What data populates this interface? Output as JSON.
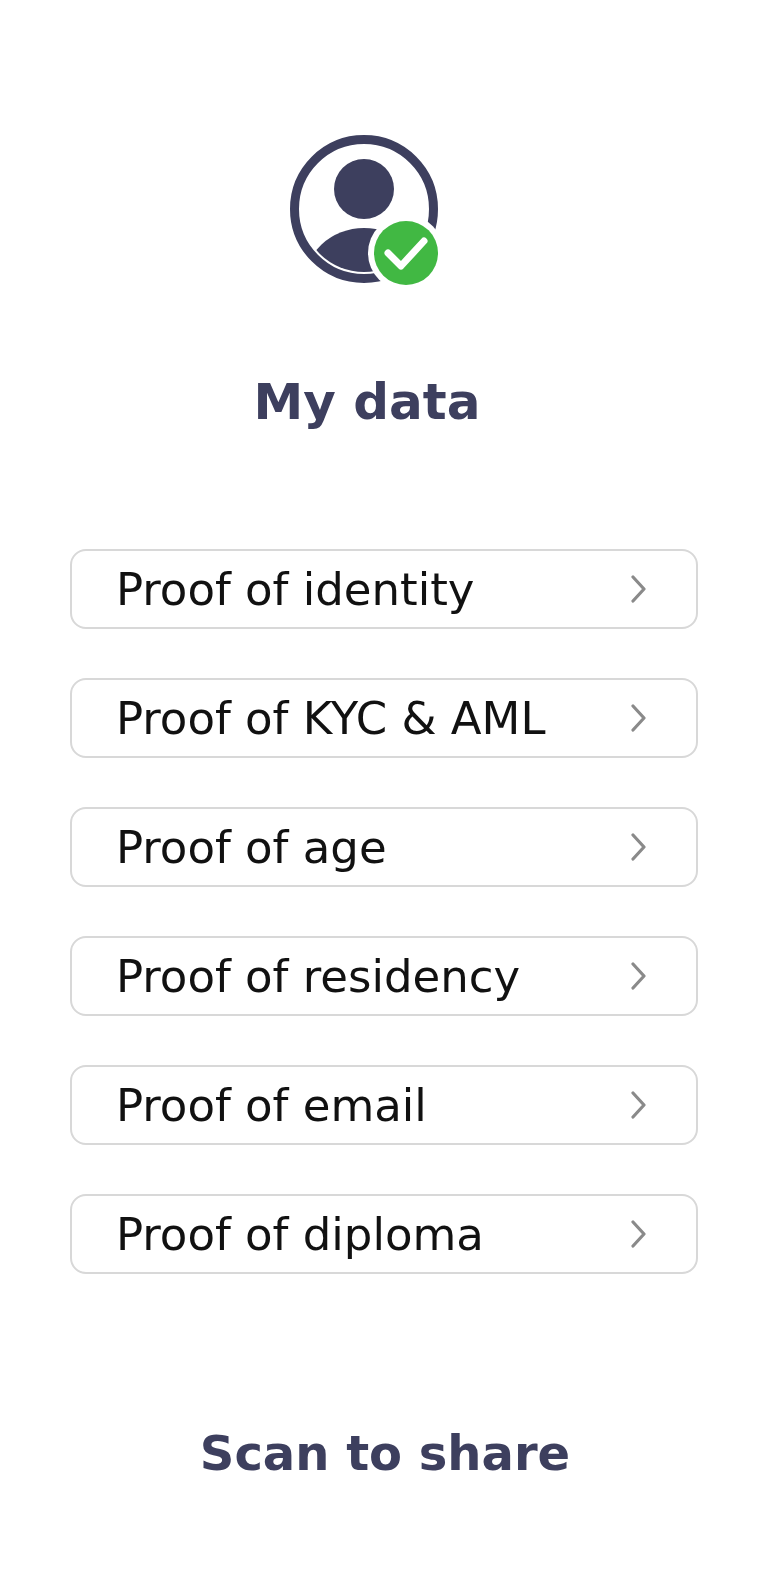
{
  "header": {
    "avatar": {
      "verified": true
    },
    "title": "My data"
  },
  "proofs": [
    {
      "label": "Proof of identity"
    },
    {
      "label": "Proof of KYC & AML"
    },
    {
      "label": "Proof of age"
    },
    {
      "label": "Proof of residency"
    },
    {
      "label": "Proof of email"
    },
    {
      "label": "Proof of diploma"
    }
  ],
  "share": {
    "label": "Scan to share"
  }
}
